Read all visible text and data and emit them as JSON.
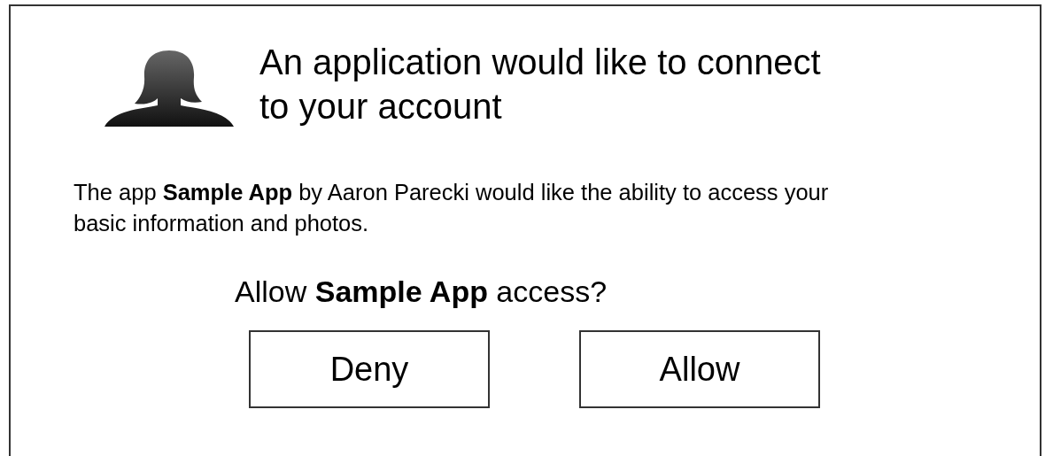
{
  "dialog": {
    "title": "An application would like to connect to your account",
    "description": "The app **Sample App** by Aaron Parecki would like the ability to access your basic information and photos.",
    "question": "Allow **Sample App** access?",
    "buttons": [
      {
        "label": "Deny"
      },
      {
        "label": "Allow"
      }
    ]
  }
}
